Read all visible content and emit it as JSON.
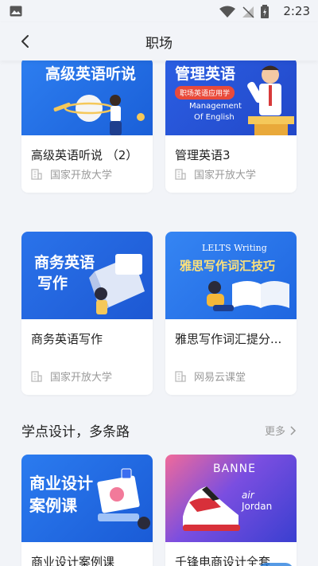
{
  "status_bar": {
    "time": "2:23"
  },
  "header": {
    "title": "职场"
  },
  "row1": [
    {
      "title": "高级英语听说 （2）",
      "org": "国家开放大学",
      "banner": "高级英语听说"
    },
    {
      "title": "管理英语3",
      "org": "国家开放大学",
      "banner": "管理英语",
      "banner_sub": "职场英语应用学",
      "banner_en1": "Management",
      "banner_en2": "Of English"
    }
  ],
  "row2": [
    {
      "title": "商务英语写作",
      "org": "国家开放大学",
      "banner1": "商务英语",
      "banner2": "写作"
    },
    {
      "title": "雅思写作词汇提分...",
      "org": "网易云课堂",
      "banner_en": "LELTS Writing",
      "banner": "雅思写作词汇技巧"
    }
  ],
  "section": {
    "title": "学点设计，多条路",
    "more": "更多"
  },
  "row3": [
    {
      "title": "商业设计案例课",
      "banner1": "商业设计",
      "banner2": "案例课"
    },
    {
      "title": "千锋电商设计全套",
      "banner_en1": "BANNE",
      "banner_en2": "air",
      "banner_en3": "Jordan"
    }
  ],
  "colors": {
    "accent": "#2f6fe8",
    "background": "#f2f4f8"
  }
}
